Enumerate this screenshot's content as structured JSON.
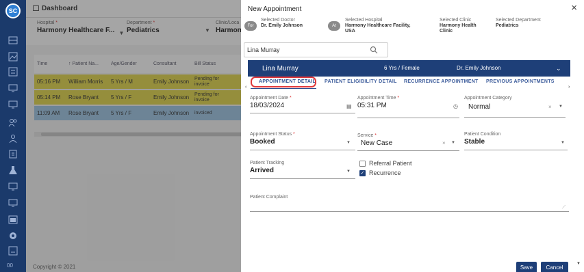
{
  "rail": {
    "logo": "SC",
    "footer": "00",
    "icons": [
      "apps-icon",
      "image-icon",
      "list-icon",
      "monitor-icon",
      "monitor-icon",
      "users-icon",
      "people-icon",
      "clipboard-icon",
      "flask-icon",
      "monitor-icon",
      "monitor-icon",
      "calendar-icon",
      "gear-icon",
      "report-icon"
    ]
  },
  "dashboard": {
    "title": "Dashboard",
    "filters": [
      {
        "label": "Hospital",
        "value": "Harmony Healthcare F..."
      },
      {
        "label": "Department",
        "value": "Pediatrics"
      },
      {
        "label": "Clinic/Loca",
        "value": "Harmon"
      }
    ],
    "columns": [
      "Time",
      "Patient Na...",
      "Age/Gender",
      "Consultant",
      "Bill Status"
    ],
    "rows": [
      {
        "time": "05:16 PM",
        "patient": "William Morris",
        "age_gender": "5 Yrs / M",
        "consultant": "Emily Johnson",
        "bill_status": "Pending for invoice",
        "color": "yellow"
      },
      {
        "time": "05:14 PM",
        "patient": "Rose Bryant",
        "age_gender": "5 Yrs / F",
        "consultant": "Emily Johnson",
        "bill_status": "Pending for invoice",
        "color": "yellow"
      },
      {
        "time": "11:09 AM",
        "patient": "Rose Bryant",
        "age_gender": "5 Yrs / F",
        "consultant": "Emily Johnson",
        "bill_status": "invoiced",
        "color": "blue"
      }
    ],
    "copyright": "Copyright © 2021"
  },
  "modal": {
    "title": "New Appointment",
    "close": "×",
    "for_pill": "For",
    "at_pill": "At",
    "selected": {
      "doctor_label": "Selected Doctor",
      "doctor": "Dr. Emily Johnson",
      "hospital_label": "Selected Hospital",
      "hospital_line1": "Harmony Healthcare Facility,",
      "hospital_line2": "USA",
      "clinic_label": "Selected Clinic",
      "clinic_line1": "Harmony Health",
      "clinic_line2": "Clinic",
      "department_label": "Selected Department",
      "department": "Pediatrics"
    },
    "patient_search": "Lina Murray",
    "patient_bar": {
      "name": "Lina Murray",
      "age_gender": "6 Yrs / Female",
      "doctor": "Dr. Emily Johnson"
    },
    "tabs": [
      "APPOINTMENT DETAIL",
      "PATIENT ELIGIBILITY DETAIL",
      "RECURRENCE APPOINTMENT",
      "PREVIOUS APPOINTMENTS"
    ],
    "fields": {
      "appointment_date": {
        "label": "Appointment Date",
        "value": "18/03/2024"
      },
      "appointment_time": {
        "label": "Appointment Time",
        "value": "05:31 PM"
      },
      "appointment_category": {
        "label": "Appointment Category",
        "value": "Normal"
      },
      "appointment_status": {
        "label": "Appointment Status",
        "value": "Booked"
      },
      "service": {
        "label": "Service",
        "value": "New Case"
      },
      "patient_condition": {
        "label": "Patient Condition",
        "value": "Stable"
      },
      "patient_tracking": {
        "label": "Patient Tracking",
        "value": "Arrived"
      },
      "referral_patient": {
        "label": "Referral Patient",
        "checked": false
      },
      "recurrence": {
        "label": "Recurrence",
        "checked": true
      },
      "patient_complaint": {
        "label": "Patient Complaint",
        "value": ""
      }
    },
    "buttons": {
      "save": "Save",
      "cancel": "Cancel"
    }
  },
  "colors": {
    "primary": "#1e3f78",
    "rail": "#1b3a6b",
    "highlight_ring": "#e0383b",
    "row_yellow": "#e4d84a",
    "row_blue": "#9fc7e6"
  }
}
